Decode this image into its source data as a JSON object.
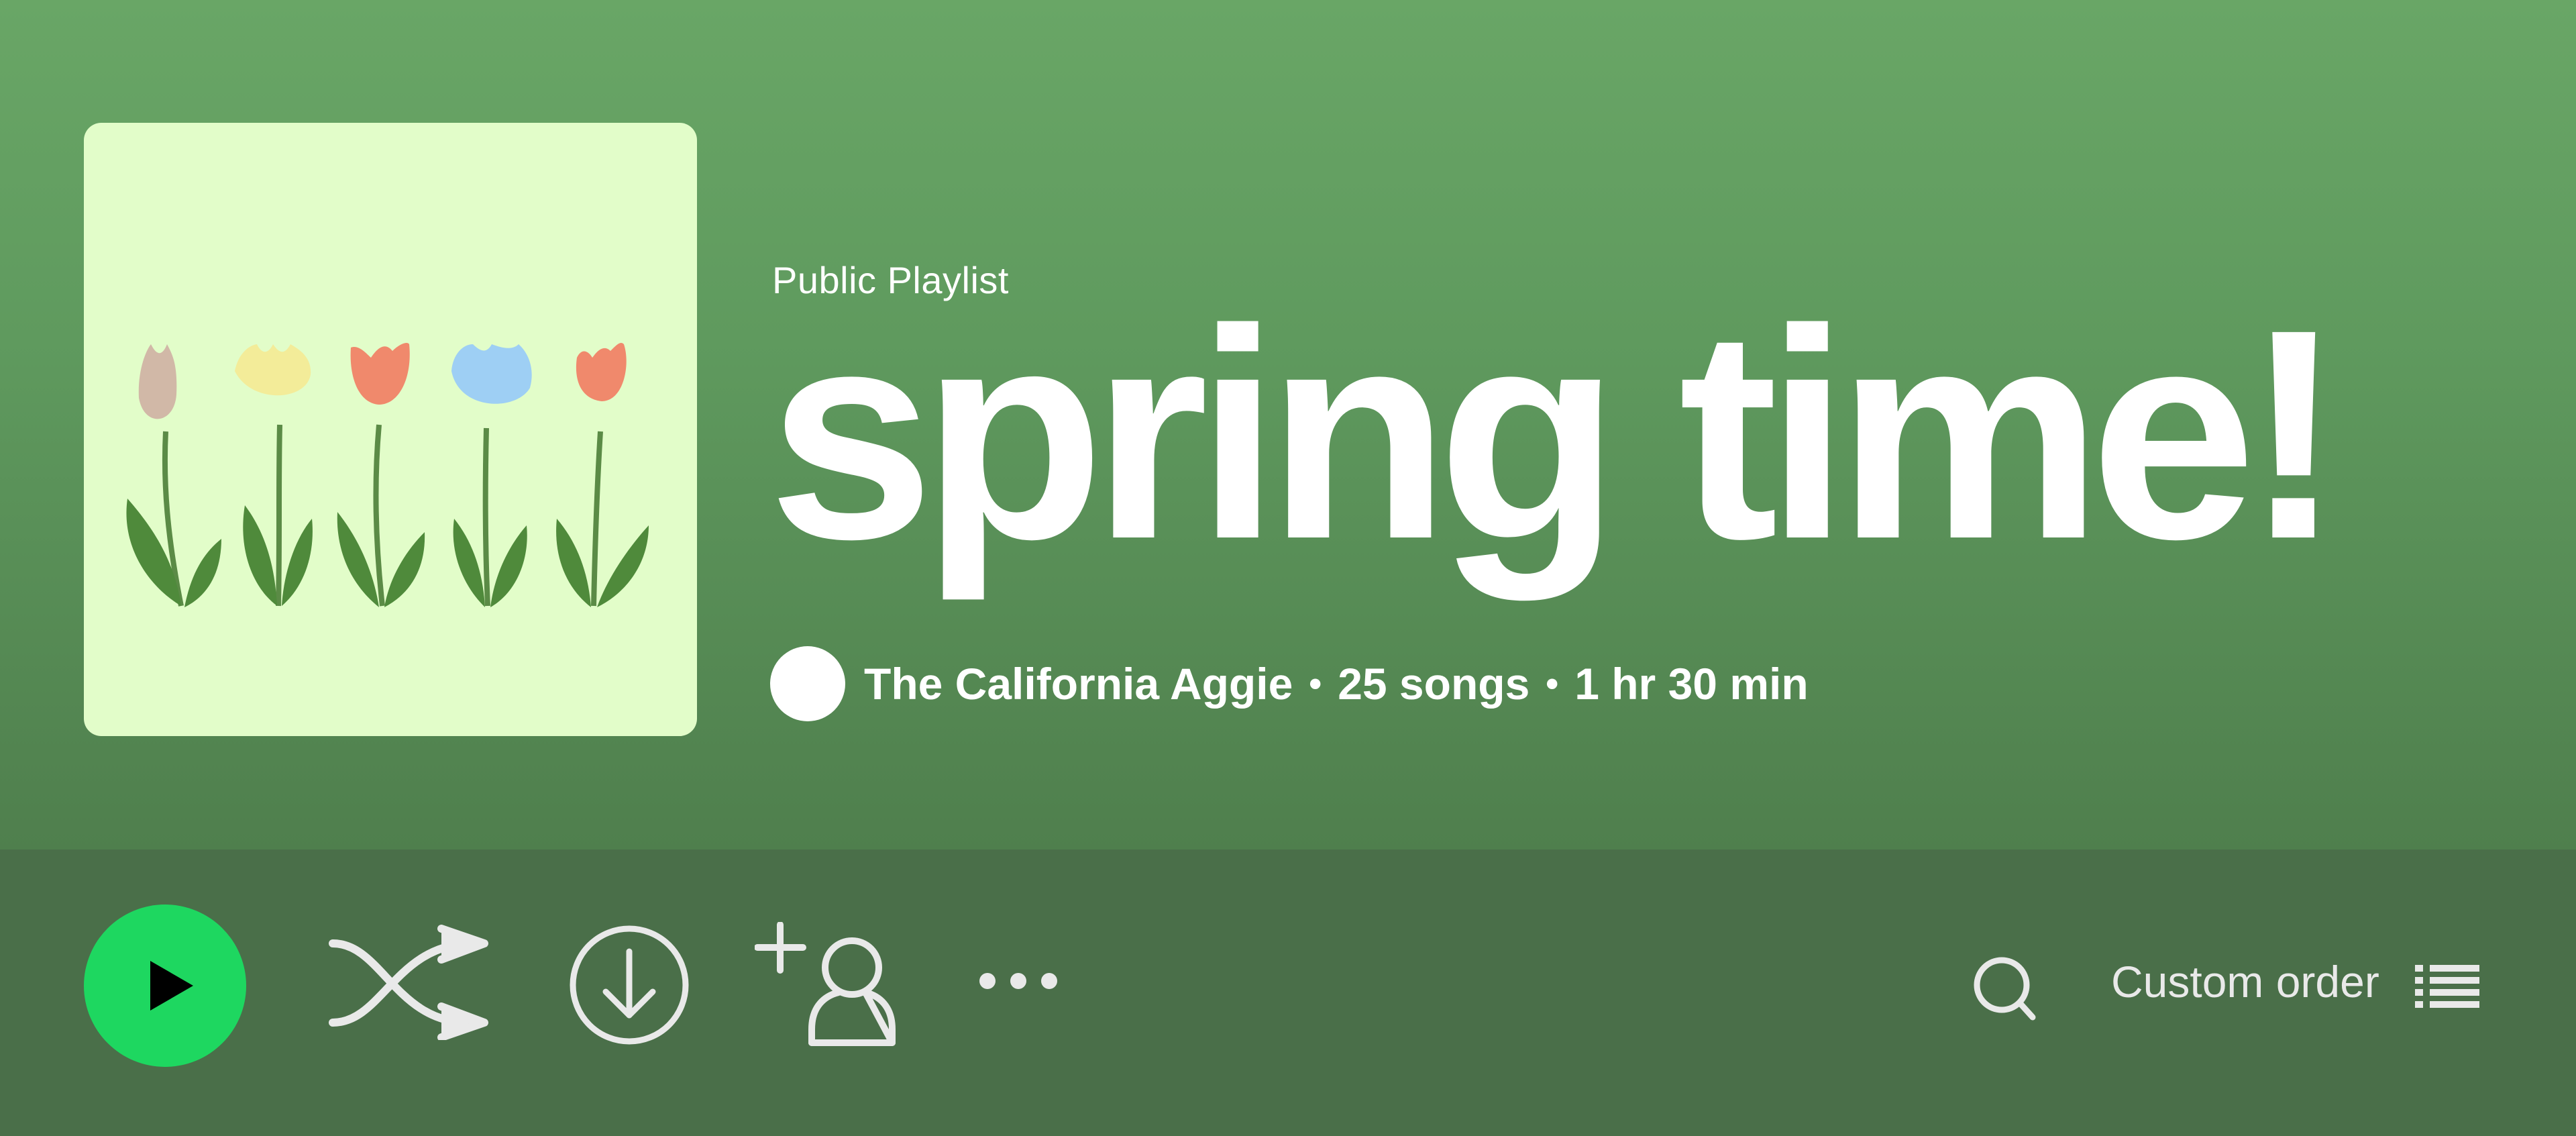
{
  "colors": {
    "header_top": "#69a666",
    "header_bottom": "#4f7f4d",
    "controls_bar": "#4a6f49",
    "play_button": "#1ed760",
    "cover_background": "#e2fdc9",
    "icon": "#e9e9e9"
  },
  "playlist": {
    "type_label": "Public Playlist",
    "title": "spring time!",
    "owner": "The California Aggie",
    "separator": "•",
    "song_count": "25 songs",
    "duration": "1 hr 30 min",
    "cover_art": "tulips-illustration"
  },
  "controls": {
    "play_icon": "play-icon",
    "shuffle_icon": "shuffle-icon",
    "download_icon": "download-icon",
    "add_user_icon": "add-user-icon",
    "more_icon": "more-options-icon",
    "search_icon": "search-icon",
    "sort_label": "Custom order",
    "sort_icon": "list-icon"
  }
}
